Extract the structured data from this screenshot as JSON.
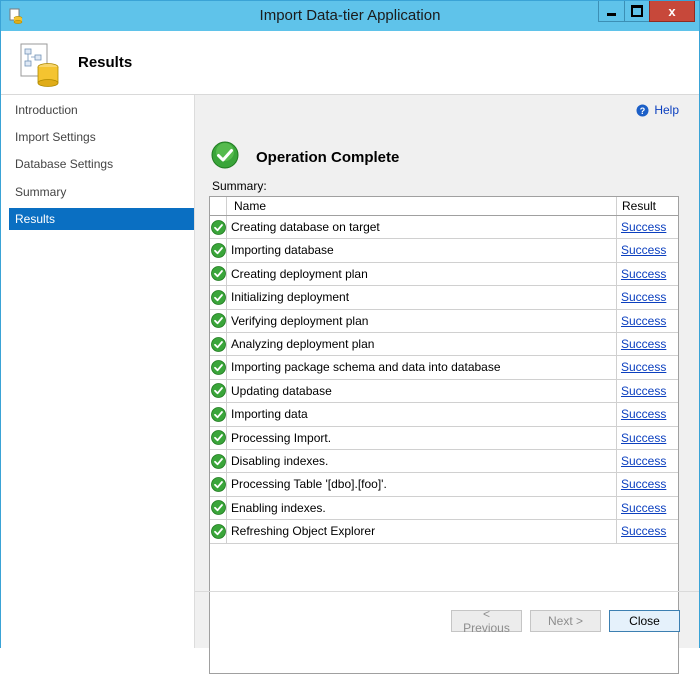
{
  "window": {
    "title": "Import Data-tier Application",
    "controls": {
      "minimize": "minimize-icon",
      "maximize": "maximize-icon",
      "close_glyph": "x"
    }
  },
  "header": {
    "title": "Results",
    "icon": "database-wizard-icon"
  },
  "sidebar": {
    "items": [
      {
        "label": "Introduction",
        "active": false
      },
      {
        "label": "Import Settings",
        "active": false
      },
      {
        "label": "Database Settings",
        "active": false
      },
      {
        "label": "Summary",
        "active": false
      },
      {
        "label": "Results",
        "active": true
      }
    ]
  },
  "help": {
    "label": "Help",
    "icon": "help-icon"
  },
  "status": {
    "title": "Operation Complete",
    "icon": "check-circle-icon"
  },
  "summary": {
    "label": "Summary:",
    "columns": {
      "name": "Name",
      "result": "Result"
    },
    "rows": [
      {
        "name": "Creating database on target",
        "result": "Success"
      },
      {
        "name": "Importing database",
        "result": "Success"
      },
      {
        "name": "Creating deployment plan",
        "result": "Success"
      },
      {
        "name": "Initializing deployment",
        "result": "Success"
      },
      {
        "name": "Verifying deployment plan",
        "result": "Success"
      },
      {
        "name": "Analyzing deployment plan",
        "result": "Success"
      },
      {
        "name": "Importing package schema and data into database",
        "result": "Success"
      },
      {
        "name": "Updating database",
        "result": "Success"
      },
      {
        "name": "Importing data",
        "result": "Success"
      },
      {
        "name": "Processing Import.",
        "result": "Success"
      },
      {
        "name": "Disabling indexes.",
        "result": "Success"
      },
      {
        "name": "Processing Table '[dbo].[foo]'.",
        "result": "Success"
      },
      {
        "name": "Enabling indexes.",
        "result": "Success"
      },
      {
        "name": "Refreshing Object Explorer",
        "result": "Success"
      }
    ]
  },
  "buttons": {
    "previous": {
      "label": "< Previous",
      "enabled": false
    },
    "next": {
      "label": "Next >",
      "enabled": false
    },
    "close": {
      "label": "Close",
      "enabled": true
    }
  },
  "colors": {
    "titlebar": "#5fc3ea",
    "selection": "#0a6fc2",
    "success": "#3aa53a",
    "link": "#0b3fbf"
  }
}
